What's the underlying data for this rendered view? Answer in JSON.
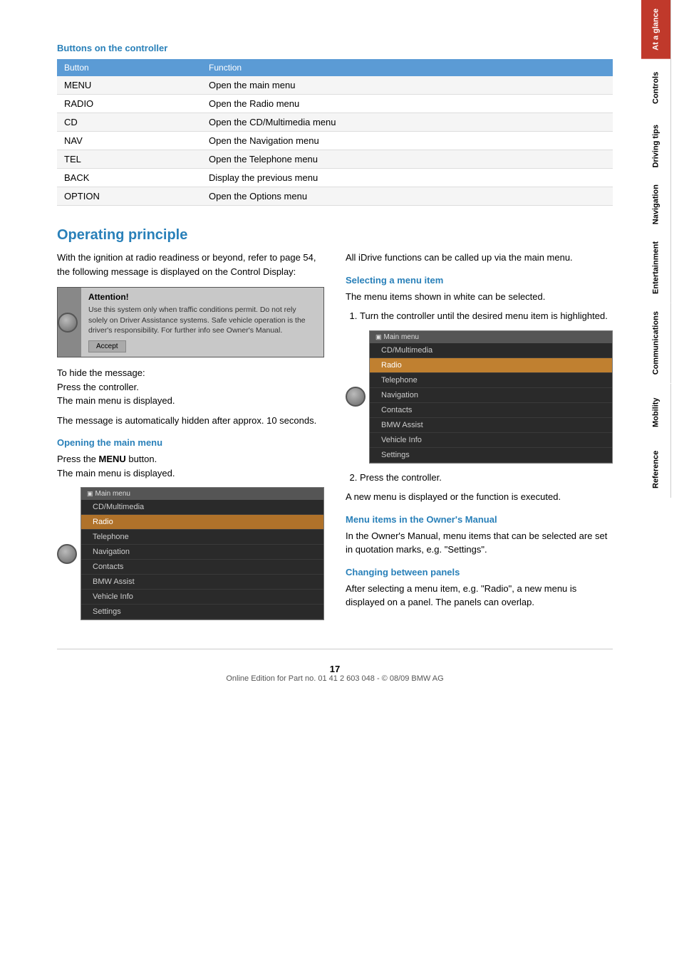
{
  "page": {
    "number": "17",
    "footer_text": "Online Edition for Part no. 01 41 2 603 048 - © 08/09 BMW AG"
  },
  "sidebar": {
    "tabs": [
      {
        "label": "At a glance",
        "active": true
      },
      {
        "label": "Controls",
        "active": false
      },
      {
        "label": "Driving tips",
        "active": false
      },
      {
        "label": "Navigation",
        "active": false
      },
      {
        "label": "Entertainment",
        "active": false
      },
      {
        "label": "Communications",
        "active": false
      },
      {
        "label": "Mobility",
        "active": false
      },
      {
        "label": "Reference",
        "active": false
      }
    ]
  },
  "buttons_section": {
    "title": "Buttons on the controller",
    "table_header": [
      "Button",
      "Function"
    ],
    "rows": [
      {
        "button": "MENU",
        "function": "Open the main menu"
      },
      {
        "button": "RADIO",
        "function": "Open the Radio menu"
      },
      {
        "button": "CD",
        "function": "Open the CD/Multimedia menu"
      },
      {
        "button": "NAV",
        "function": "Open the Navigation menu"
      },
      {
        "button": "TEL",
        "function": "Open the Telephone menu"
      },
      {
        "button": "BACK",
        "function": "Display the previous menu"
      },
      {
        "button": "OPTION",
        "function": "Open the Options menu"
      }
    ]
  },
  "operating_principle": {
    "title": "Operating principle",
    "intro": "With the ignition at radio readiness or beyond, refer to page 54, the following message is displayed on the Control Display:",
    "attention": {
      "title": "Attention!",
      "lines": [
        "Use this system only when traffic",
        "conditions permit. Do not rely solely",
        "on Driver Assistance systems.",
        "Safe vehicle operation is the",
        "driver's responsibility.",
        "For further info see Owner's Manual."
      ],
      "accept_label": "Accept"
    },
    "hide_message": "To hide the message:",
    "press_controller": "Press the controller.",
    "main_menu_displayed": "The main menu is displayed.",
    "auto_hidden": "The message is automatically hidden after approx. 10 seconds.",
    "opening_main_menu": {
      "title": "Opening the main menu",
      "text1": "Press the",
      "bold": "MENU",
      "text2": "button.",
      "text3": "The main menu is displayed."
    },
    "menu_items": [
      "CD/Multimedia",
      "Radio",
      "Telephone",
      "Navigation",
      "Contacts",
      "BMW Assist",
      "Vehicle Info",
      "Settings"
    ],
    "right_col": {
      "intro": "All iDrive functions can be called up via the main menu.",
      "selecting_title": "Selecting a menu item",
      "selecting_text": "The menu items shown in white can be selected.",
      "step1": "Turn the controller until the desired menu item is highlighted.",
      "step2": "Press the controller.",
      "step2_result": "A new menu is displayed or the function is executed.",
      "owners_manual_title": "Menu items in the Owner's Manual",
      "owners_manual_text": "In the Owner's Manual, menu items that can be selected are set in quotation marks, e.g. \"Settings\".",
      "changing_panels_title": "Changing between panels",
      "changing_panels_text": "After selecting a menu item, e.g. \"Radio\", a new menu is displayed on a panel. The panels can overlap.",
      "menu_items_highlight": [
        "CD/Multimedia",
        "Radio",
        "Telephone",
        "Navigation",
        "Contacts",
        "BMW Assist",
        "Vehicle Info",
        "Settings"
      ]
    }
  }
}
